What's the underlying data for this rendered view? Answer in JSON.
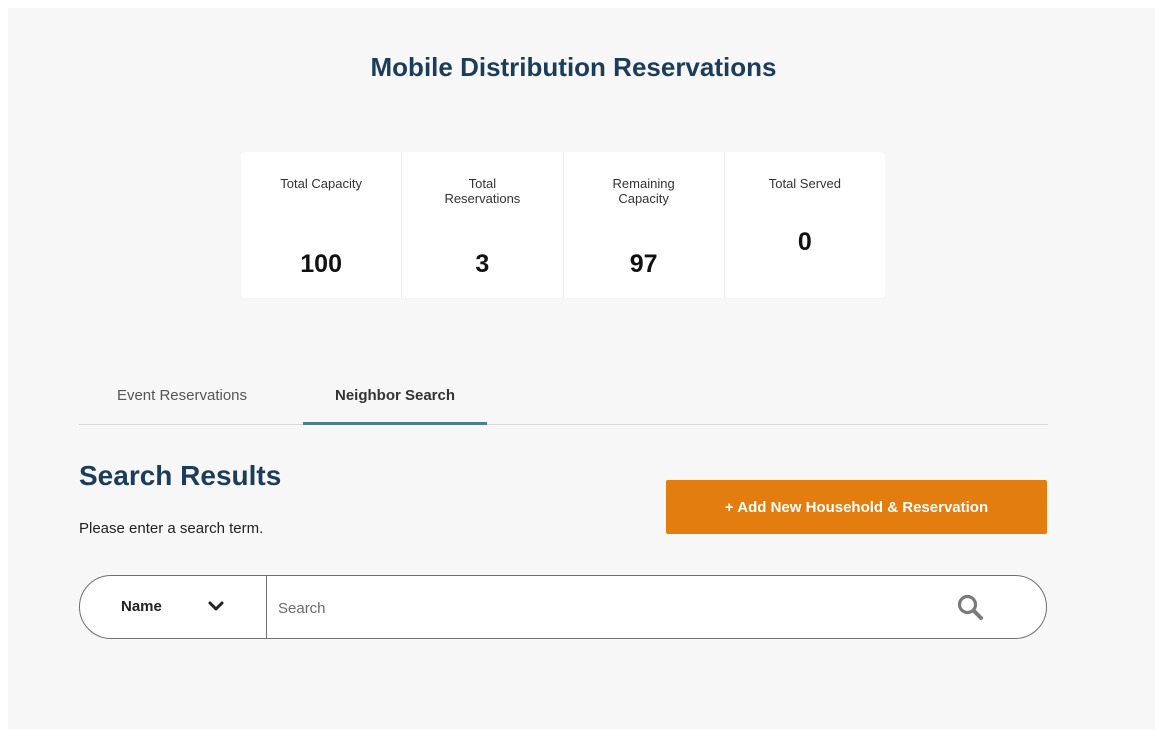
{
  "header": {
    "title": "Mobile Distribution Reservations"
  },
  "stats": [
    {
      "label": "Total Capacity",
      "value": "100"
    },
    {
      "label": "Total Reservations",
      "value": "3"
    },
    {
      "label": "Remaining Capacity",
      "value": "97"
    },
    {
      "label": "Total Served",
      "value": "0"
    }
  ],
  "tabs": [
    {
      "label": "Event Reservations",
      "active": false
    },
    {
      "label": "Neighbor Search",
      "active": true
    }
  ],
  "results": {
    "title": "Search Results",
    "hint": "Please enter a search term.",
    "add_button_label": "+ Add New Household & Reservation"
  },
  "search": {
    "type_selected": "Name",
    "placeholder": "Search",
    "value": ""
  },
  "icons": {
    "chevron": "chevron-down-icon",
    "search": "search-icon"
  },
  "colors": {
    "title": "#1c3d5a",
    "accent_button": "#e37d0f",
    "active_tab_underline": "#4a7f8c",
    "panel_background": "#f7f7f7"
  }
}
